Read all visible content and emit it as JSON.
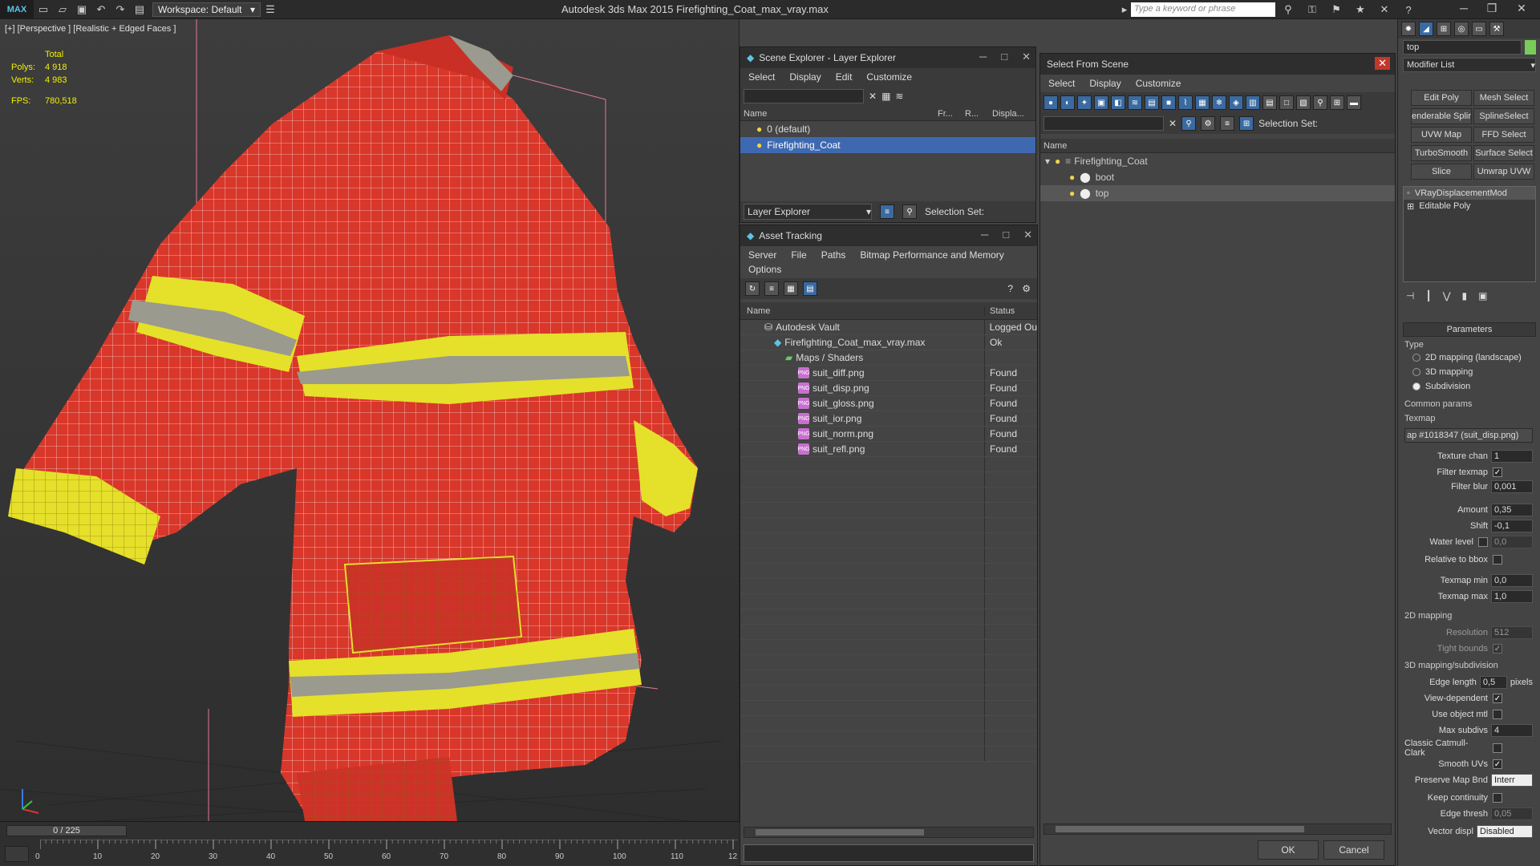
{
  "app": {
    "logo": "MAX",
    "title": "Autodesk 3ds Max  2015     Firefighting_Coat_max_vray.max",
    "workspace": "Workspace: Default",
    "search_placeholder": "Type a keyword or phrase"
  },
  "viewport": {
    "label": "[+] [Perspective ] [Realistic + Edged Faces ]",
    "stats": {
      "total_label": "Total",
      "polys_label": "Polys:",
      "polys": "4 918",
      "verts_label": "Verts:",
      "verts": "4 983",
      "fps_label": "FPS:",
      "fps": "780,518"
    }
  },
  "timeline": {
    "slider": "0 / 225",
    "ticks": [
      "0",
      "10",
      "20",
      "30",
      "40",
      "50",
      "60",
      "70",
      "80",
      "90",
      "100",
      "110",
      "12"
    ]
  },
  "scene_explorer": {
    "title": "Scene Explorer - Layer Explorer",
    "menu": [
      "Select",
      "Display",
      "Edit",
      "Customize"
    ],
    "columns": [
      "Name",
      "Fr...",
      "R...",
      "Displa..."
    ],
    "rows": [
      "0 (default)",
      "Firefighting_Coat"
    ],
    "footer_dropdown": "Layer Explorer",
    "footer_sel": "Selection Set:"
  },
  "asset_tracking": {
    "title": "Asset Tracking",
    "menu": [
      "Server",
      "File",
      "Paths",
      "Bitmap Performance and Memory"
    ],
    "menu2": "Options",
    "columns": [
      "Name",
      "Status"
    ],
    "rows": [
      {
        "name": "Autodesk Vault",
        "status": "Logged Ou"
      },
      {
        "name": "Firefighting_Coat_max_vray.max",
        "status": "Ok"
      },
      {
        "name": "Maps / Shaders",
        "status": ""
      },
      {
        "name": "suit_diff.png",
        "status": "Found"
      },
      {
        "name": "suit_disp.png",
        "status": "Found"
      },
      {
        "name": "suit_gloss.png",
        "status": "Found"
      },
      {
        "name": "suit_ior.png",
        "status": "Found"
      },
      {
        "name": "suit_norm.png",
        "status": "Found"
      },
      {
        "name": "suit_refl.png",
        "status": "Found"
      }
    ]
  },
  "select_from_scene": {
    "title": "Select From Scene",
    "menu": [
      "Select",
      "Display",
      "Customize"
    ],
    "selection_set": "Selection Set:",
    "column": "Name",
    "rows": [
      "Firefighting_Coat",
      "boot",
      "top"
    ],
    "ok": "OK",
    "cancel": "Cancel"
  },
  "command_panel": {
    "name_field": "top",
    "modifier_list": "Modifier List",
    "buttons": [
      "Edit Poly",
      "Mesh Select",
      "enderable Splir",
      "SplineSelect",
      "UVW Map",
      "FFD Select",
      "TurboSmooth",
      "Surface Select",
      "Slice",
      "Unwrap UVW"
    ],
    "stack": [
      "VRayDisplacementMod",
      "Editable Poly"
    ],
    "parameters": {
      "title": "Parameters",
      "type_label": "Type",
      "types": [
        "2D mapping (landscape)",
        "3D mapping",
        "Subdivision"
      ],
      "common": "Common params",
      "texmap_label": "Texmap",
      "texmap_value": "ap #1018347 (suit_disp.png)",
      "texture_chan_label": "Texture chan",
      "texture_chan": "1",
      "filter_texmap": "Filter texmap",
      "filter_blur_label": "Filter blur",
      "filter_blur": "0,001",
      "amount_label": "Amount",
      "amount": "0,35",
      "shift_label": "Shift",
      "shift": "-0,1",
      "water_label": "Water level",
      "water": "0,0",
      "relative_bbox": "Relative to bbox",
      "texmap_min_label": "Texmap min",
      "texmap_min": "0,0",
      "texmap_max_label": "Texmap max",
      "texmap_max": "1,0",
      "mapping2d": "2D mapping",
      "resolution_label": "Resolution",
      "resolution": "512",
      "tight_bounds": "Tight bounds",
      "mapping3d": "3D mapping/subdivision",
      "edge_length_label": "Edge length",
      "edge_length": "0,5",
      "pixels": "pixels",
      "view_dependent": "View-dependent",
      "use_object_mtl": "Use object mtl",
      "max_subdivs_label": "Max subdivs",
      "max_subdivs": "4",
      "classic_catmull": "Classic Catmull-Clark",
      "smooth_uvs": "Smooth UVs",
      "preserve_map_label": "Preserve Map Bnd",
      "preserve_map": "Interr",
      "keep_continuity": "Keep continuity",
      "edge_thresh_label": "Edge thresh",
      "edge_thresh": "0,05",
      "vector_displ_label": "Vector displ",
      "vector_displ": "Disabled"
    }
  },
  "colors": {
    "coat_red": "#d8372a",
    "reflective_yellow": "#e5e02a",
    "reflective_gray": "#9a9a8e",
    "selection_blue": "#3e69b0"
  }
}
